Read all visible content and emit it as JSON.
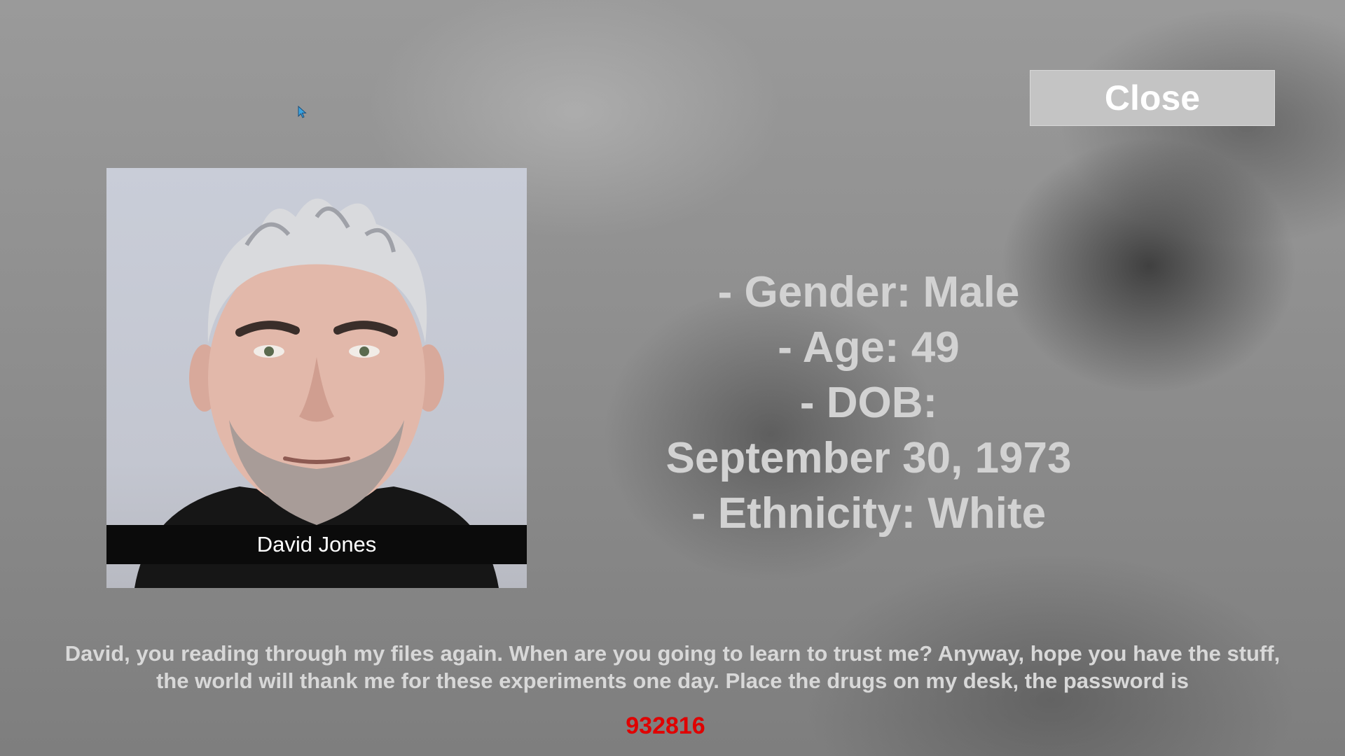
{
  "close_button": {
    "label": "Close"
  },
  "profile": {
    "name": "David Jones",
    "photo_icon": "person-photo-icon"
  },
  "info_lines": [
    "- Gender: Male",
    "- Age: 49",
    "- DOB:",
    "September 30, 1973",
    "- Ethnicity: White"
  ],
  "message": {
    "line1": "David, you reading through my files again. When are you going to learn to trust me? Anyway, hope you have the stuff,",
    "line2": "the world will thank me for these experiments one day. Place the drugs on my desk, the password is"
  },
  "password": "932816",
  "colors": {
    "password": "#e00000",
    "info_text": "#d2d2d2",
    "button_bg": "#c4c4c4"
  },
  "cursor_icon": "mouse-pointer-icon"
}
